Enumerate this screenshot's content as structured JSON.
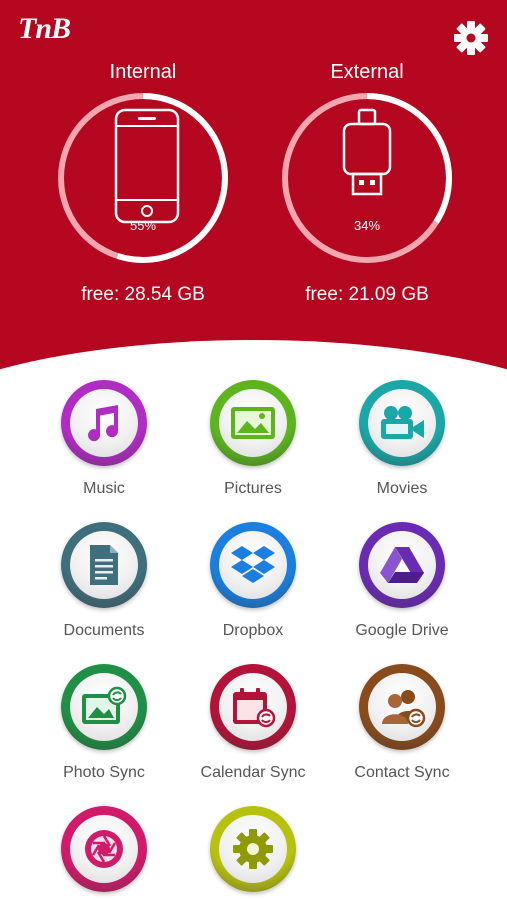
{
  "header": {
    "logo": "TnB",
    "background_color": "#b5071f"
  },
  "storage": {
    "internal": {
      "title": "Internal",
      "percent_label": "55%",
      "used_fraction": 0.55,
      "free": "free: 28.54 GB"
    },
    "external": {
      "title": "External",
      "percent_label": "34%",
      "used_fraction": 0.34,
      "free": "free: 21.09 GB"
    }
  },
  "apps": [
    {
      "label": "Music",
      "icon": "music-note-icon",
      "color": "#b02cc4"
    },
    {
      "label": "Pictures",
      "icon": "picture-icon",
      "color": "#5db51e"
    },
    {
      "label": "Movies",
      "icon": "video-camera-icon",
      "color": "#1aa7a7"
    },
    {
      "label": "Documents",
      "icon": "document-icon",
      "color": "#3f6e7c"
    },
    {
      "label": "Dropbox",
      "icon": "dropbox-icon",
      "color": "#1a7fe0"
    },
    {
      "label": "Google Drive",
      "icon": "google-drive-icon",
      "color": "#6a2bb4"
    },
    {
      "label": "Photo Sync",
      "icon": "photo-sync-icon",
      "color": "#1f8f45"
    },
    {
      "label": "Calendar Sync",
      "icon": "calendar-sync-icon",
      "color": "#b5123a"
    },
    {
      "label": "Contact Sync",
      "icon": "contact-sync-icon",
      "color": "#8a4b1c"
    },
    {
      "label": "",
      "icon": "camera-aperture-icon",
      "color": "#d11a6a"
    },
    {
      "label": "",
      "icon": "gear-icon",
      "color": "#b8c20e"
    }
  ]
}
